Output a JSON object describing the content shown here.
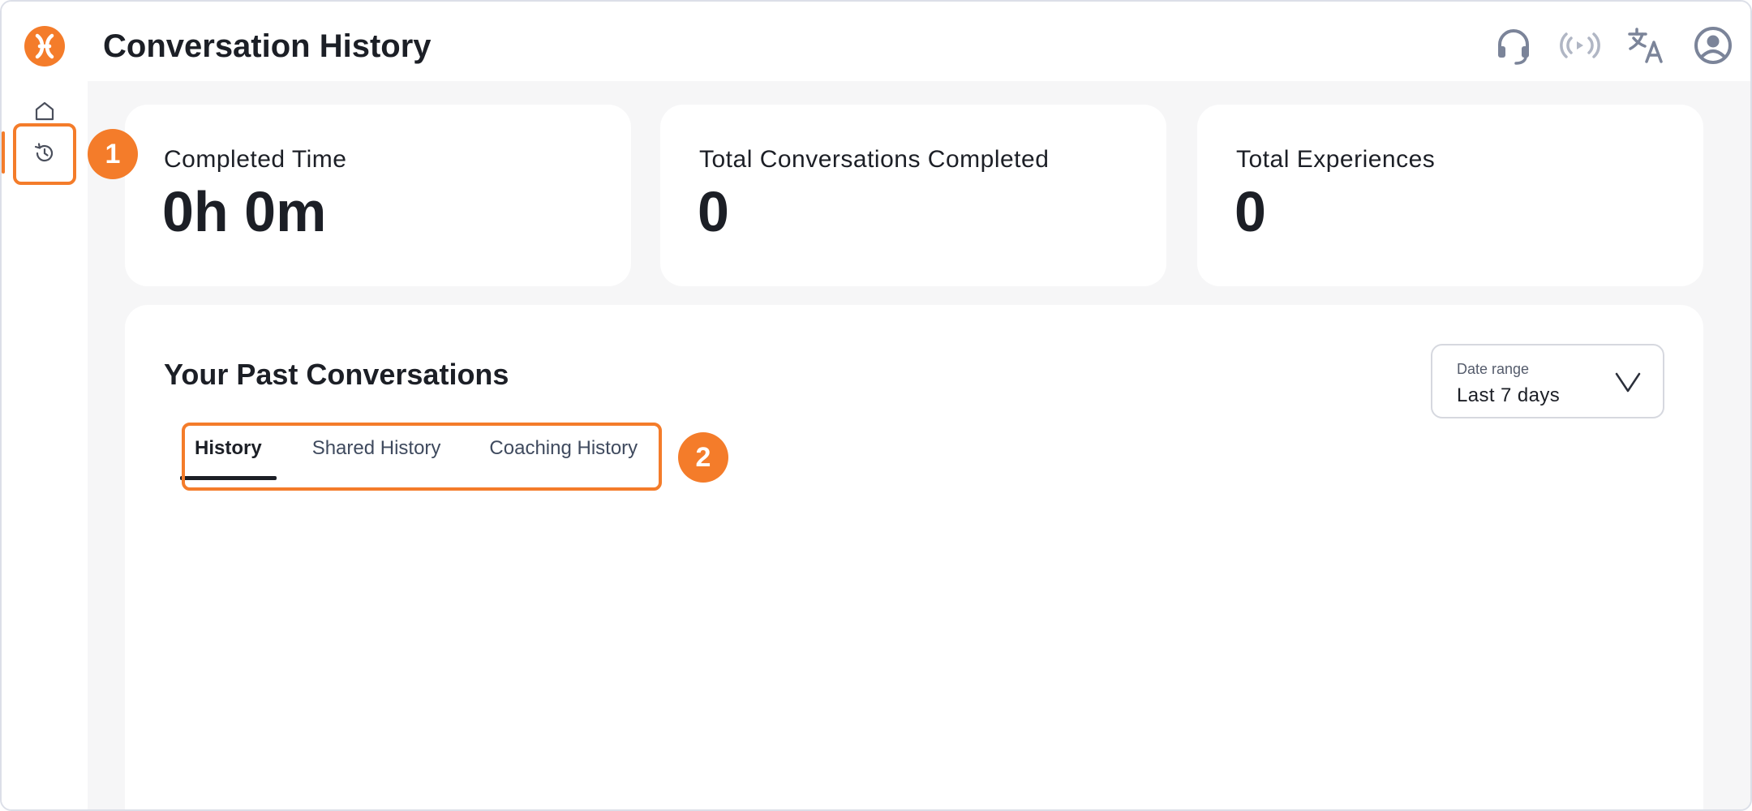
{
  "header": {
    "title": "Conversation History",
    "logo_icon": "brand-logo-icon",
    "icons": [
      "headset-icon",
      "broadcast-icon",
      "translate-icon",
      "account-icon"
    ]
  },
  "sidebar": {
    "items": [
      {
        "name": "home",
        "icon": "home-icon"
      },
      {
        "name": "history",
        "icon": "history-icon",
        "active": true
      }
    ]
  },
  "stats": [
    {
      "label": "Completed Time",
      "value": "0h 0m"
    },
    {
      "label": "Total Conversations Completed",
      "value": "0"
    },
    {
      "label": "Total Experiences",
      "value": "0"
    }
  ],
  "past": {
    "title": "Your Past Conversations",
    "tabs": [
      {
        "label": "History",
        "active": true
      },
      {
        "label": "Shared History"
      },
      {
        "label": "Coaching History"
      }
    ],
    "date_range": {
      "label": "Date range",
      "value": "Last 7 days"
    }
  },
  "annotations": {
    "callout_1": "1",
    "callout_2": "2"
  },
  "colors": {
    "accent": "#f47c2a",
    "text": "#1c1f26",
    "icon_gray": "#7b8499",
    "page_bg": "#f6f6f7"
  }
}
